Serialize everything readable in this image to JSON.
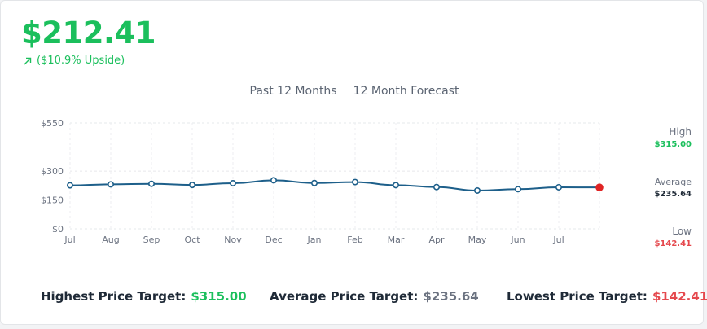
{
  "header": {
    "price": "$212.41",
    "upside": "($10.9% Upside)",
    "upside_icon": "arrow-up-right-icon",
    "accent_color": "#1bbf5c"
  },
  "tabs": [
    {
      "label": "Past 12 Months"
    },
    {
      "label": "12 Month Forecast"
    }
  ],
  "summary": {
    "high_label": "High",
    "high_value": "$315.00",
    "average_label": "Average",
    "average_value": "$235.64",
    "low_label": "Low",
    "low_value": "$142.41",
    "high_color": "#1bbf5c",
    "low_color": "#e5484d"
  },
  "footer": {
    "highest_label": "Highest Price Target:",
    "highest_value": "$315.00",
    "average_label": "Average Price Target:",
    "average_value": "$235.64",
    "lowest_label": "Lowest Price Target:",
    "lowest_value": "$142.41"
  },
  "chart_data": {
    "type": "line",
    "x": [
      "Jul",
      "Aug",
      "Sep",
      "Oct",
      "Nov",
      "Dec",
      "Jan",
      "Feb",
      "Mar",
      "Apr",
      "May",
      "Jun",
      "Jul",
      ""
    ],
    "xticks": [
      "Jul",
      "Aug",
      "Sep",
      "Oct",
      "Nov",
      "Dec",
      "Jan",
      "Feb",
      "Mar",
      "Apr",
      "May",
      "Jun",
      "Jul"
    ],
    "series": [
      {
        "values": [
          226,
          231,
          234,
          228,
          237,
          252,
          238,
          243,
          227,
          217,
          199,
          206,
          216,
          215
        ],
        "color": "#1d5f8a"
      }
    ],
    "ylim": [
      0,
      550
    ],
    "yticks": [
      {
        "value": 0,
        "label": "$0"
      },
      {
        "value": 150,
        "label": "$150"
      },
      {
        "value": 300,
        "label": "$300"
      },
      {
        "value": 550,
        "label": "$550"
      }
    ],
    "grid": true,
    "last_point_color": "#e02424"
  }
}
